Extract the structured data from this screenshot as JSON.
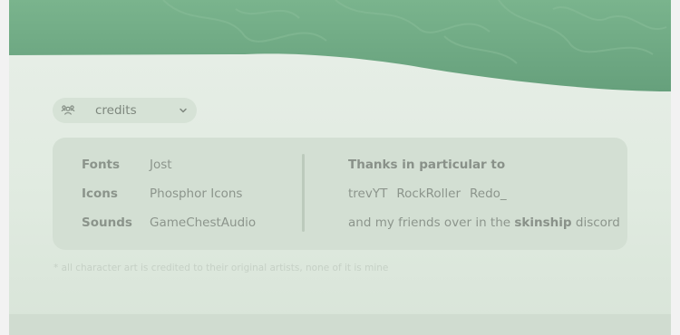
{
  "dropdown": {
    "label": "credits",
    "icon": "users-three-icon",
    "chevron": "caret-down-icon"
  },
  "credits": {
    "rows": [
      {
        "key": "Fonts",
        "value": "Jost"
      },
      {
        "key": "Icons",
        "value": "Phosphor Icons"
      },
      {
        "key": "Sounds",
        "value": "GameChestAudio"
      }
    ],
    "thanks_title": "Thanks in particular to",
    "names": [
      "trevYT",
      "RockRoller",
      "Redo_"
    ],
    "friends_prefix": "and my friends over in the ",
    "friends_bold": "skinship",
    "friends_suffix": " discord"
  },
  "note": "* all character art is credited to their original artists, none of it is mine",
  "colors": {
    "banner": "#6ea883",
    "background": "#e1ebe1",
    "panel": "#d3dfd3",
    "text": "#8c958c"
  }
}
